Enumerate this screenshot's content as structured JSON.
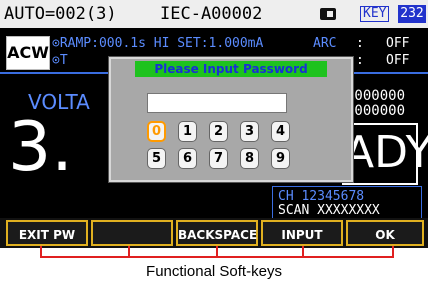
{
  "status_bar": {
    "auto_label": "AUTO=002(3)",
    "test_name": "IEC-A00002",
    "key_badge": "KEY",
    "interface_badge": "232"
  },
  "mode": "ACW",
  "params": {
    "ramp": "RAMP:000.1s",
    "hi_set": "HI SET:1.000mA",
    "row2_prefix": "T",
    "arc_label": "ARC",
    "colon": ":",
    "arc_value": "OFF",
    "row2_value": "OFF"
  },
  "main": {
    "voltage_label": "VOLTA",
    "voltage_digit": "3.",
    "right_value_1": "0000000",
    "right_value_2": "0000000",
    "status_text": "ADY"
  },
  "channels": {
    "ch_row": "CH 12345678",
    "scan_row": "SCAN XXXXXXXX"
  },
  "dialog": {
    "title": "Please Input Password",
    "input_value": "",
    "keys_row1": [
      "0",
      "1",
      "2",
      "3",
      "4"
    ],
    "keys_row2": [
      "5",
      "6",
      "7",
      "8",
      "9"
    ],
    "selected_key": "0"
  },
  "softkeys": [
    "EXIT PW",
    "",
    "BACKSPACE",
    "INPUT",
    "OK"
  ],
  "caption": "Functional Soft-keys",
  "colors": {
    "accent_blue": "#5b8cff",
    "title_green": "#1ec21e",
    "softkey_border": "#e0b020",
    "callout_red": "#e02020",
    "selected_key": "#ff9a00"
  }
}
